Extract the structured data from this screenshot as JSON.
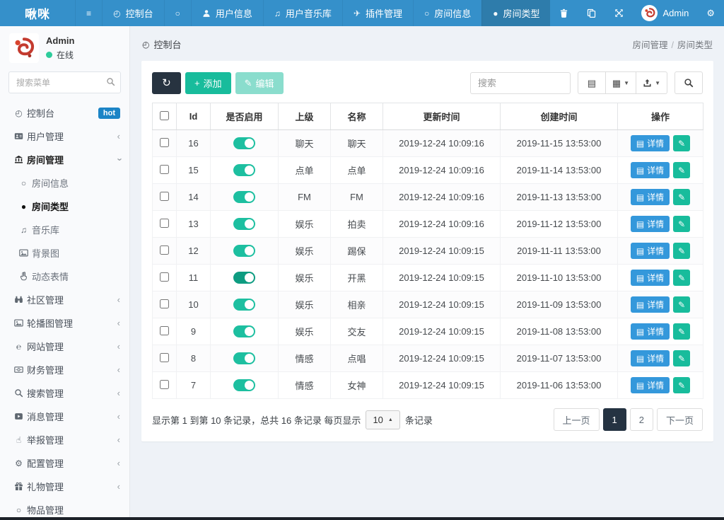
{
  "colors": {
    "topbar_blue": "#3590ca",
    "topbar_active": "#2e7cab",
    "green": "#18bc9c",
    "toggle_green": "#1dbfa0",
    "detail_blue": "#3498db",
    "dark_navy": "#273340",
    "badge_blue": "#1c84c6",
    "online_dot": "#2ecc9b",
    "content_bg": "#eef2f7"
  },
  "topbar": {
    "brand": "啾咪",
    "tabs": [
      {
        "key": "sidebar-toggle",
        "icon": "menu-icon",
        "label": ""
      },
      {
        "key": "console",
        "icon": "dashboard-icon",
        "label": "控制台"
      },
      {
        "key": "blank",
        "icon": "circle-o-icon",
        "label": ""
      },
      {
        "key": "user-info",
        "icon": "user-icon",
        "label": "用户信息"
      },
      {
        "key": "user-music",
        "icon": "music-icon",
        "label": "用户音乐库"
      },
      {
        "key": "plugin-mgmt",
        "icon": "paper-plane-icon",
        "label": "插件管理"
      },
      {
        "key": "room-info",
        "icon": "circle-o-icon",
        "label": "房间信息"
      },
      {
        "key": "room-type",
        "icon": "circle-icon",
        "label": "房间类型",
        "active": true
      }
    ],
    "right_icons": [
      {
        "key": "trash",
        "icon": "trash-icon"
      },
      {
        "key": "copy",
        "icon": "copy-icon"
      },
      {
        "key": "fullscreen",
        "icon": "arrows-icon"
      }
    ],
    "user": {
      "name": "Admin"
    },
    "settings": {
      "key": "settings",
      "icon": "cogs-icon"
    }
  },
  "sidebar": {
    "user": {
      "name": "Admin",
      "status": "在线"
    },
    "search_placeholder": "搜索菜单",
    "items": [
      {
        "key": "console",
        "icon": "dashboard-icon",
        "label": "控制台",
        "badge": "hot"
      },
      {
        "key": "user-mgmt",
        "icon": "id-card-icon",
        "label": "用户管理",
        "chevron": "left"
      },
      {
        "key": "room-mgmt",
        "icon": "bank-icon",
        "label": "房间管理",
        "chevron": "down",
        "expanded": true,
        "children": [
          {
            "key": "room-info",
            "icon": "circle-o-icon",
            "label": "房间信息"
          },
          {
            "key": "room-type",
            "icon": "circle-icon",
            "label": "房间类型",
            "active": true
          },
          {
            "key": "music-lib",
            "icon": "music-icon",
            "label": "音乐库"
          },
          {
            "key": "background",
            "icon": "image-icon",
            "label": "背景图"
          },
          {
            "key": "emotes",
            "icon": "hand-peace-icon",
            "label": "动态表情"
          }
        ]
      },
      {
        "key": "community-mgmt",
        "icon": "binoculars-icon",
        "label": "社区管理",
        "chevron": "left"
      },
      {
        "key": "carousel-mgmt",
        "icon": "image-icon",
        "label": "轮播图管理",
        "chevron": "left"
      },
      {
        "key": "website-mgmt",
        "icon": "ie-icon",
        "label": "网站管理",
        "chevron": "left"
      },
      {
        "key": "finance-mgmt",
        "icon": "money-icon",
        "label": "财务管理",
        "chevron": "left"
      },
      {
        "key": "search-mgmt",
        "icon": "search-icon",
        "label": "搜索管理",
        "chevron": "left"
      },
      {
        "key": "message-mgmt",
        "icon": "message-icon",
        "label": "消息管理",
        "chevron": "left"
      },
      {
        "key": "report-mgmt",
        "icon": "hand-pointer-icon",
        "label": "举报管理",
        "chevron": "left"
      },
      {
        "key": "config-mgmt",
        "icon": "config-icon",
        "label": "配置管理",
        "chevron": "left"
      },
      {
        "key": "gift-mgmt",
        "icon": "gift-icon",
        "label": "礼物管理",
        "chevron": "left"
      },
      {
        "key": "goods-mgmt",
        "icon": "circle-o-icon",
        "label": "物品管理"
      }
    ]
  },
  "breadcrumb": {
    "left": "控制台",
    "path": [
      "房间管理",
      "房间类型"
    ]
  },
  "toolbar": {
    "add_label": "添加",
    "edit_label": "编辑",
    "search_placeholder": "搜索",
    "view_buttons": [
      {
        "key": "toggle-view",
        "icon": "list-view-icon"
      },
      {
        "key": "columns",
        "icon": "columns-icon",
        "caret": true
      },
      {
        "key": "export",
        "icon": "export-icon",
        "caret": true
      }
    ]
  },
  "table": {
    "columns": [
      "Id",
      "是否启用",
      "上级",
      "名称",
      "更新时间",
      "创建时间",
      "操作"
    ],
    "detail_label": "详情",
    "rows": [
      {
        "id": "16",
        "enabled": true,
        "parent": "聊天",
        "name": "聊天",
        "updated": "2019-12-24 10:09:16",
        "created": "2019-11-15 13:53:00"
      },
      {
        "id": "15",
        "enabled": true,
        "parent": "点单",
        "name": "点单",
        "updated": "2019-12-24 10:09:16",
        "created": "2019-11-14 13:53:00"
      },
      {
        "id": "14",
        "enabled": true,
        "parent": "FM",
        "name": "FM",
        "updated": "2019-12-24 10:09:16",
        "created": "2019-11-13 13:53:00"
      },
      {
        "id": "13",
        "enabled": true,
        "parent": "娱乐",
        "name": "拍卖",
        "updated": "2019-12-24 10:09:16",
        "created": "2019-11-12 13:53:00"
      },
      {
        "id": "12",
        "enabled": true,
        "parent": "娱乐",
        "name": "踢保",
        "updated": "2019-12-24 10:09:15",
        "created": "2019-11-11 13:53:00"
      },
      {
        "id": "11",
        "enabled": true,
        "dark": true,
        "parent": "娱乐",
        "name": "开黑",
        "updated": "2019-12-24 10:09:15",
        "created": "2019-11-10 13:53:00"
      },
      {
        "id": "10",
        "enabled": true,
        "parent": "娱乐",
        "name": "相亲",
        "updated": "2019-12-24 10:09:15",
        "created": "2019-11-09 13:53:00"
      },
      {
        "id": "9",
        "enabled": true,
        "parent": "娱乐",
        "name": "交友",
        "updated": "2019-12-24 10:09:15",
        "created": "2019-11-08 13:53:00"
      },
      {
        "id": "8",
        "enabled": true,
        "parent": "情感",
        "name": "点唱",
        "updated": "2019-12-24 10:09:15",
        "created": "2019-11-07 13:53:00"
      },
      {
        "id": "7",
        "enabled": true,
        "parent": "情感",
        "name": "女神",
        "updated": "2019-12-24 10:09:15",
        "created": "2019-11-06 13:53:00"
      }
    ]
  },
  "footer": {
    "summary_prefix": "显示第 1 到第 10 条记录，总共 16 条记录 每页显示",
    "page_size": "10",
    "summary_suffix": "条记录",
    "pagination": [
      {
        "key": "prev",
        "label": "上一页"
      },
      {
        "key": "page-1",
        "label": "1",
        "active": true
      },
      {
        "key": "page-2",
        "label": "2"
      },
      {
        "key": "next",
        "label": "下一页"
      }
    ]
  }
}
